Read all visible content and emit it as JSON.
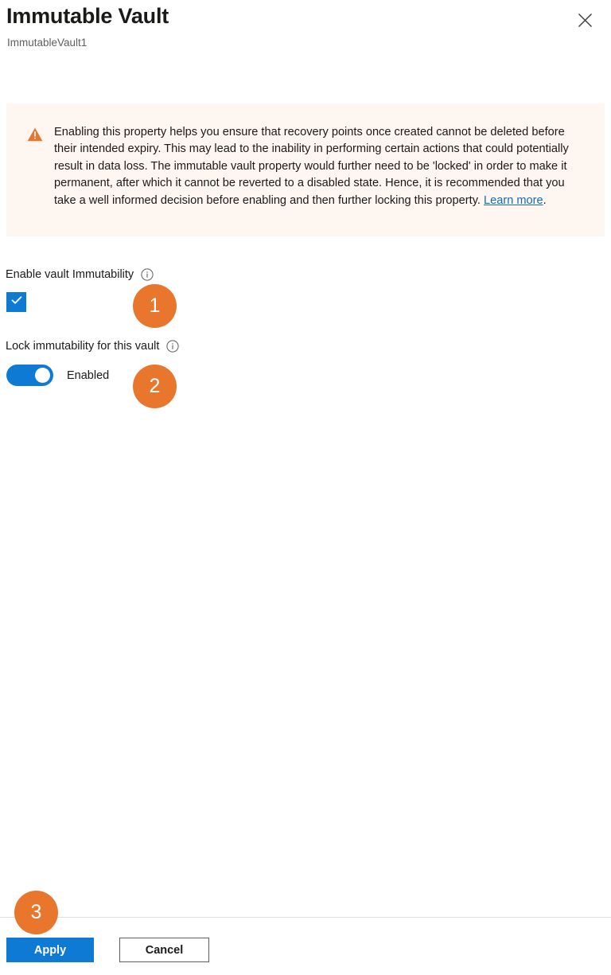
{
  "header": {
    "title": "Immutable Vault",
    "subtitle": "ImmutableVault1",
    "close_icon": "close-icon"
  },
  "warning": {
    "icon": "warning-triangle-icon",
    "text": "Enabling this property helps you ensure that recovery points once created cannot be deleted before their intended expiry. This may lead to the inability in performing certain actions that could potentially result in data loss. The immutable vault property would further need to be 'locked' in order to make it permanent, after which it cannot be reverted to a disabled state. Hence, it is recommended that you take a well informed decision before enabling and then further locking this property. ",
    "link_text": "Learn more",
    "text_after_link": ".",
    "background_color": "#fdf6f1",
    "icon_color": "#e8762c",
    "link_color": "#0f6cbd"
  },
  "fields": {
    "enable_immutability": {
      "label": "Enable vault Immutability",
      "info_icon": "info-icon",
      "checked": true
    },
    "lock_immutability": {
      "label": "Lock immutability for this vault",
      "info_icon": "info-icon",
      "toggle_state_label": "Enabled",
      "enabled": true
    }
  },
  "badges": [
    {
      "number": "1"
    },
    {
      "number": "2"
    },
    {
      "number": "3"
    }
  ],
  "footer": {
    "apply_label": "Apply",
    "cancel_label": "Cancel"
  },
  "colors": {
    "accent_blue": "#0f7ad4",
    "badge_orange": "#e8762c",
    "warning_bg": "#fdf6f1"
  }
}
